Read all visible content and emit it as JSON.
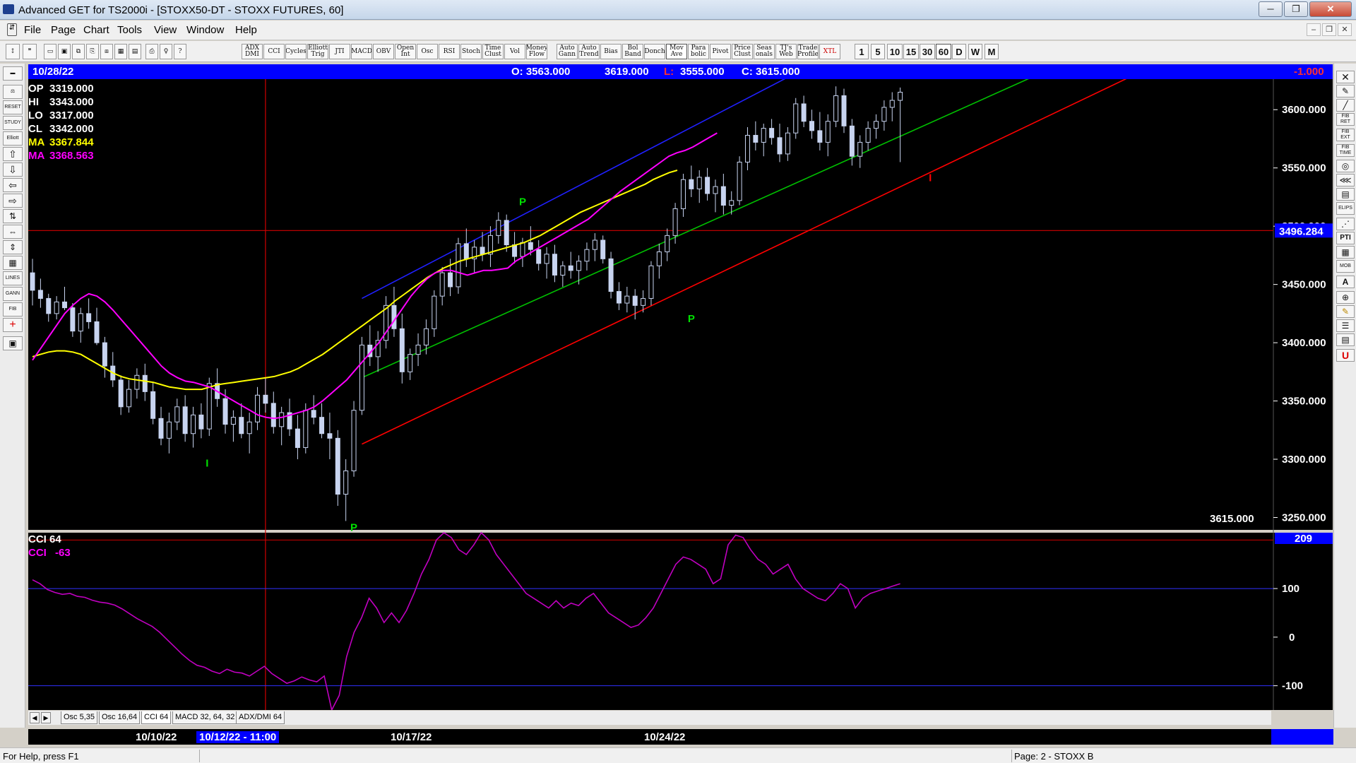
{
  "window": {
    "title": "Advanced GET for TS2000i - [STOXX50-DT - STOXX FUTURES, 60]",
    "minimize": "─",
    "maximize": "❐",
    "close": "✕"
  },
  "menu": {
    "items": [
      "File",
      "Page",
      "Chart",
      "Tools",
      "View",
      "Window",
      "Help"
    ],
    "mdi_min": "–",
    "mdi_restore": "❐",
    "mdi_close": "✕"
  },
  "toolbar": {
    "indicators": [
      "ADX DMI",
      "CCI",
      "Cycles",
      "Elliott Trig",
      "JTI",
      "MACD",
      "OBV",
      "Open Int",
      "Osc",
      "RSI",
      "Stoch",
      "Time Clust",
      "Vol",
      "Money Flow",
      "Auto Gann",
      "Auto Trend",
      "Bias",
      "Bol Band",
      "Donch",
      "Mov Ave",
      "Para bolic",
      "Pivot",
      "Price Clust",
      "Seas onals",
      "TJ's Web",
      "Trade Profile",
      "XTL"
    ],
    "timeframes": [
      "1",
      "5",
      "10",
      "15",
      "30",
      "60",
      "D",
      "W",
      "M"
    ]
  },
  "lefttools": [
    "RESET",
    "STUDY",
    "Elliott",
    "LINES",
    "GANN",
    "FIB"
  ],
  "righttools": [
    "FIB RET",
    "FIB EXT",
    "FIB TIME",
    "ELIPS",
    "PTI",
    "MOB",
    "A",
    "U"
  ],
  "ohlc": {
    "date": "10/28/22",
    "open": "O: 3563.000",
    "high": "3619.000",
    "low_label": "L:",
    "low": "3555.000",
    "close": "C: 3615.000",
    "change": "-1.000"
  },
  "legend": {
    "op_label": "OP",
    "op": "3319.000",
    "hi_label": "HI",
    "hi": "3343.000",
    "lo_label": "LO",
    "lo": "3317.000",
    "cl_label": "CL",
    "cl": "3342.000",
    "ma1_label": "MA",
    "ma1": "3367.844",
    "ma2_label": "MA",
    "ma2": "3368.563"
  },
  "colors": {
    "background": "#000000",
    "candle": "#c8d4f0",
    "ma_yellow": "#ffff00",
    "ma_magenta": "#ff00ff",
    "channel_blue": "#2020ff",
    "channel_red": "#ff0000",
    "trend_green": "#00c000",
    "pivot_green": "#00e000",
    "cci": "#c000c0",
    "crosshair": "#d00000",
    "title_blue": "#0000ff"
  },
  "chart_data": {
    "type": "candlestick",
    "price_axis": {
      "ticks": [
        "3600.000",
        "3550.000",
        "3500.000",
        "3450.000",
        "3400.000",
        "3350.000",
        "3300.000",
        "3250.000"
      ],
      "range": [
        3240,
        3625
      ]
    },
    "crosshair_price": "3496.284",
    "last_price": "3615.000",
    "pivots": [
      {
        "label": "I",
        "bar": 22,
        "price": 3302
      },
      {
        "label": "P",
        "bar": 40,
        "price": 3247
      },
      {
        "label": "P",
        "bar": 61,
        "price": 3512
      },
      {
        "label": "P",
        "bar": 82,
        "price": 3426
      },
      {
        "label": "I",
        "bar": 112,
        "price": 3547
      }
    ],
    "cci_panel": {
      "label": "CCI 64",
      "value_label": "CCI",
      "value": "-63",
      "marker": "209",
      "ticks": [
        "100",
        "0",
        "-100"
      ],
      "range": [
        -150,
        215
      ],
      "values": [
        118,
        110,
        98,
        92,
        88,
        90,
        84,
        82,
        76,
        72,
        70,
        66,
        58,
        48,
        38,
        30,
        22,
        10,
        -5,
        -20,
        -35,
        -48,
        -58,
        -62,
        -70,
        -75,
        -66,
        -72,
        -74,
        -80,
        -70,
        -60,
        -75,
        -85,
        -95,
        -90,
        -82,
        -88,
        -92,
        -80,
        -150,
        -120,
        -40,
        10,
        40,
        80,
        60,
        30,
        50,
        30,
        55,
        90,
        130,
        160,
        200,
        215,
        205,
        180,
        170,
        190,
        215,
        200,
        170,
        150,
        130,
        110,
        90,
        80,
        70,
        60,
        75,
        60,
        70,
        65,
        80,
        90,
        70,
        50,
        40,
        30,
        20,
        25,
        40,
        60,
        90,
        120,
        150,
        165,
        160,
        150,
        140,
        110,
        120,
        190,
        210,
        205,
        180,
        160,
        150,
        130,
        140,
        150,
        120,
        100,
        90,
        80,
        75,
        90,
        110,
        100,
        60,
        80,
        90,
        95,
        100,
        105,
        110
      ]
    },
    "x_axis": {
      "labels": [
        "10/10/22",
        "10/12/22 - 11:00",
        "10/17/22",
        "10/24/22"
      ],
      "label_bars": [
        15,
        29,
        52,
        88
      ],
      "selected": "10/12/22 - 11:00"
    },
    "bars": [
      [
        3460,
        3472,
        3432,
        3445
      ],
      [
        3445,
        3455,
        3430,
        3438
      ],
      [
        3438,
        3442,
        3418,
        3425
      ],
      [
        3425,
        3440,
        3420,
        3435
      ],
      [
        3435,
        3448,
        3428,
        3430
      ],
      [
        3430,
        3434,
        3405,
        3410
      ],
      [
        3410,
        3430,
        3400,
        3425
      ],
      [
        3425,
        3438,
        3412,
        3418
      ],
      [
        3418,
        3430,
        3398,
        3400
      ],
      [
        3400,
        3405,
        3370,
        3380
      ],
      [
        3380,
        3392,
        3362,
        3368
      ],
      [
        3368,
        3372,
        3338,
        3345
      ],
      [
        3345,
        3368,
        3340,
        3360
      ],
      [
        3360,
        3378,
        3352,
        3372
      ],
      [
        3372,
        3382,
        3350,
        3358
      ],
      [
        3358,
        3366,
        3330,
        3335
      ],
      [
        3335,
        3345,
        3312,
        3318
      ],
      [
        3318,
        3340,
        3305,
        3332
      ],
      [
        3332,
        3352,
        3325,
        3345
      ],
      [
        3345,
        3355,
        3315,
        3322
      ],
      [
        3322,
        3345,
        3310,
        3338
      ],
      [
        3338,
        3348,
        3318,
        3326
      ],
      [
        3326,
        3370,
        3320,
        3365
      ],
      [
        3365,
        3378,
        3345,
        3352
      ],
      [
        3352,
        3360,
        3322,
        3330
      ],
      [
        3330,
        3342,
        3315,
        3336
      ],
      [
        3336,
        3348,
        3318,
        3322
      ],
      [
        3322,
        3340,
        3305,
        3332
      ],
      [
        3332,
        3362,
        3325,
        3355
      ],
      [
        3355,
        3370,
        3340,
        3348
      ],
      [
        3348,
        3358,
        3322,
        3328
      ],
      [
        3328,
        3345,
        3312,
        3340
      ],
      [
        3340,
        3352,
        3320,
        3326
      ],
      [
        3326,
        3338,
        3300,
        3310
      ],
      [
        3310,
        3348,
        3305,
        3342
      ],
      [
        3342,
        3355,
        3330,
        3336
      ],
      [
        3336,
        3348,
        3318,
        3322
      ],
      [
        3322,
        3340,
        3300,
        3318
      ],
      [
        3318,
        3325,
        3260,
        3270
      ],
      [
        3270,
        3300,
        3247,
        3290
      ],
      [
        3290,
        3350,
        3285,
        3342
      ],
      [
        3342,
        3405,
        3338,
        3398
      ],
      [
        3398,
        3415,
        3380,
        3388
      ],
      [
        3388,
        3410,
        3375,
        3402
      ],
      [
        3402,
        3440,
        3395,
        3432
      ],
      [
        3432,
        3448,
        3405,
        3412
      ],
      [
        3412,
        3425,
        3365,
        3375
      ],
      [
        3375,
        3395,
        3368,
        3390
      ],
      [
        3390,
        3408,
        3380,
        3398
      ],
      [
        3398,
        3420,
        3390,
        3412
      ],
      [
        3412,
        3445,
        3405,
        3440
      ],
      [
        3440,
        3465,
        3432,
        3460
      ],
      [
        3460,
        3472,
        3440,
        3448
      ],
      [
        3448,
        3490,
        3442,
        3485
      ],
      [
        3485,
        3498,
        3465,
        3472
      ],
      [
        3472,
        3488,
        3460,
        3482
      ],
      [
        3482,
        3495,
        3470,
        3476
      ],
      [
        3476,
        3500,
        3465,
        3492
      ],
      [
        3492,
        3512,
        3485,
        3505
      ],
      [
        3505,
        3510,
        3478,
        3484
      ],
      [
        3484,
        3495,
        3468,
        3474
      ],
      [
        3474,
        3490,
        3465,
        3486
      ],
      [
        3486,
        3500,
        3475,
        3480
      ],
      [
        3480,
        3488,
        3462,
        3468
      ],
      [
        3468,
        3482,
        3455,
        3476
      ],
      [
        3476,
        3484,
        3452,
        3458
      ],
      [
        3458,
        3470,
        3448,
        3466
      ],
      [
        3466,
        3478,
        3455,
        3462
      ],
      [
        3462,
        3475,
        3450,
        3470
      ],
      [
        3470,
        3486,
        3462,
        3480
      ],
      [
        3480,
        3494,
        3470,
        3488
      ],
      [
        3488,
        3492,
        3468,
        3472
      ],
      [
        3472,
        3478,
        3438,
        3444
      ],
      [
        3444,
        3452,
        3428,
        3434
      ],
      [
        3434,
        3448,
        3426,
        3440
      ],
      [
        3440,
        3446,
        3420,
        3432
      ],
      [
        3432,
        3445,
        3426,
        3438
      ],
      [
        3438,
        3470,
        3432,
        3466
      ],
      [
        3466,
        3485,
        3455,
        3478
      ],
      [
        3478,
        3498,
        3470,
        3492
      ],
      [
        3492,
        3520,
        3485,
        3515
      ],
      [
        3515,
        3545,
        3508,
        3540
      ],
      [
        3540,
        3552,
        3525,
        3532
      ],
      [
        3532,
        3548,
        3520,
        3542
      ],
      [
        3542,
        3550,
        3522,
        3528
      ],
      [
        3528,
        3540,
        3512,
        3534
      ],
      [
        3534,
        3545,
        3510,
        3518
      ],
      [
        3518,
        3530,
        3510,
        3522
      ],
      [
        3522,
        3560,
        3518,
        3555
      ],
      [
        3555,
        3585,
        3548,
        3578
      ],
      [
        3578,
        3590,
        3565,
        3572
      ],
      [
        3572,
        3588,
        3560,
        3584
      ],
      [
        3584,
        3592,
        3570,
        3576
      ],
      [
        3576,
        3588,
        3555,
        3562
      ],
      [
        3562,
        3585,
        3556,
        3580
      ],
      [
        3580,
        3610,
        3575,
        3605
      ],
      [
        3605,
        3612,
        3585,
        3590
      ],
      [
        3590,
        3600,
        3575,
        3582
      ],
      [
        3582,
        3598,
        3565,
        3572
      ],
      [
        3572,
        3596,
        3560,
        3590
      ],
      [
        3590,
        3620,
        3585,
        3612
      ],
      [
        3612,
        3618,
        3580,
        3586
      ],
      [
        3586,
        3592,
        3552,
        3560
      ],
      [
        3560,
        3578,
        3550,
        3572
      ],
      [
        3572,
        3590,
        3565,
        3584
      ],
      [
        3584,
        3596,
        3575,
        3590
      ],
      [
        3590,
        3608,
        3582,
        3602
      ],
      [
        3602,
        3615,
        3590,
        3608
      ],
      [
        3608,
        3619,
        3555,
        3615
      ]
    ],
    "ma_yellow": [
      3388,
      3390,
      3392,
      3393,
      3393,
      3392,
      3390,
      3386,
      3382,
      3378,
      3374,
      3371,
      3369,
      3368,
      3367,
      3366,
      3364,
      3362,
      3361,
      3360,
      3360,
      3360,
      3362,
      3364,
      3365,
      3366,
      3367,
      3368,
      3369,
      3370,
      3371,
      3373,
      3375,
      3378,
      3382,
      3386,
      3390,
      3395,
      3400,
      3405,
      3410,
      3415,
      3420,
      3425,
      3430,
      3436,
      3441,
      3446,
      3451,
      3456,
      3460,
      3464,
      3467,
      3470,
      3472,
      3474,
      3476,
      3478,
      3480,
      3482,
      3484,
      3486,
      3489,
      3492,
      3496,
      3500,
      3504,
      3508,
      3512,
      3515,
      3518,
      3521,
      3524,
      3527,
      3530,
      3533,
      3536,
      3540,
      3543,
      3546,
      3548
    ],
    "ma_yellow_start_bar": 0,
    "ma_magenta": [
      3385,
      3395,
      3405,
      3415,
      3425,
      3432,
      3438,
      3442,
      3440,
      3435,
      3428,
      3420,
      3412,
      3404,
      3396,
      3388,
      3380,
      3374,
      3370,
      3367,
      3366,
      3364,
      3362,
      3358,
      3354,
      3350,
      3346,
      3342,
      3338,
      3336,
      3335,
      3336,
      3338,
      3340,
      3342,
      3345,
      3350,
      3356,
      3362,
      3368,
      3376,
      3384,
      3392,
      3400,
      3410,
      3420,
      3430,
      3440,
      3448,
      3455,
      3460,
      3462,
      3462,
      3460,
      3458,
      3460,
      3462,
      3462,
      3463,
      3464,
      3470,
      3474,
      3478,
      3482,
      3486,
      3490,
      3494,
      3498,
      3502,
      3506,
      3512,
      3518,
      3524,
      3530,
      3535,
      3540,
      3545,
      3550,
      3555,
      3560,
      3563,
      3565,
      3568,
      3572,
      3576,
      3580
    ],
    "ma_magenta_start_bar": 0
  },
  "tabs": {
    "items": [
      "Osc 5,35",
      "Osc 16,64",
      "CCI 64",
      "MACD 32, 64, 32",
      "ADX/DMI 64"
    ],
    "active": "CCI 64",
    "prev": "◀",
    "next": "▶"
  },
  "status": {
    "help": "For Help, press F1",
    "page": "Page: 2 - STOXX B"
  }
}
